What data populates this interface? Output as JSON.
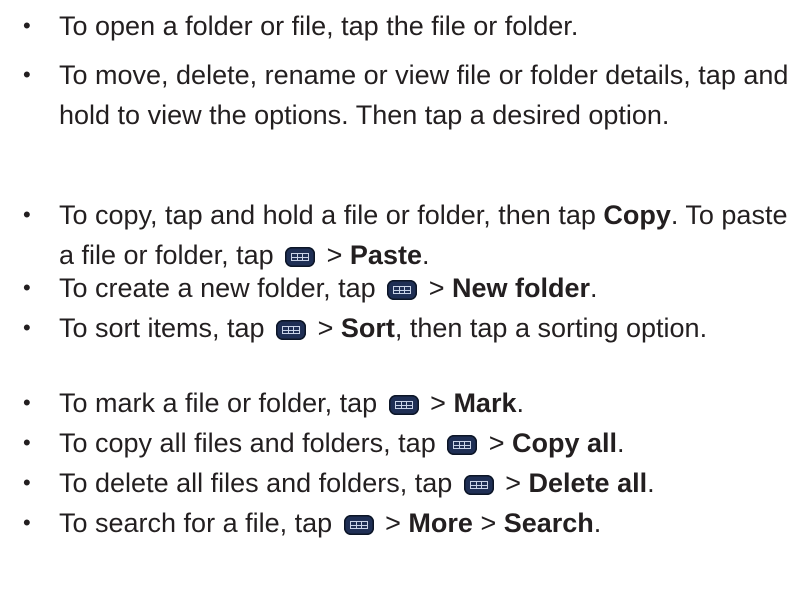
{
  "icon": "menu-icon",
  "items": [
    {
      "segments": [
        {
          "text": "To open a folder or file, tap the file or folder."
        }
      ]
    },
    {
      "segments": [
        {
          "text": "To move, delete, rename or view file or folder details, tap and hold to view the options. Then tap a desired option."
        }
      ]
    },
    {
      "segments": [
        {
          "text": "To copy, tap and hold a file or folder, then tap "
        },
        {
          "text": "Copy",
          "bold": true
        },
        {
          "text": ". To paste a file or folder, tap "
        },
        {
          "icon": "menu-icon"
        },
        {
          "text": " > "
        },
        {
          "text": "Paste",
          "bold": true
        },
        {
          "text": "."
        }
      ]
    },
    {
      "segments": [
        {
          "text": "To create a new folder, tap "
        },
        {
          "icon": "menu-icon"
        },
        {
          "text": " > "
        },
        {
          "text": "New folder",
          "bold": true
        },
        {
          "text": "."
        }
      ]
    },
    {
      "segments": [
        {
          "text": "To sort items, tap "
        },
        {
          "icon": "menu-icon"
        },
        {
          "text": " > "
        },
        {
          "text": "Sort",
          "bold": true
        },
        {
          "text": ", then tap a sorting option."
        }
      ]
    },
    {
      "segments": [
        {
          "text": "To mark a file or folder, tap "
        },
        {
          "icon": "menu-icon"
        },
        {
          "text": " > "
        },
        {
          "text": "Mark",
          "bold": true
        },
        {
          "text": "."
        }
      ]
    },
    {
      "segments": [
        {
          "text": "To copy all files and folders, tap "
        },
        {
          "icon": "menu-icon"
        },
        {
          "text": " > "
        },
        {
          "text": "Copy all",
          "bold": true
        },
        {
          "text": "."
        }
      ]
    },
    {
      "segments": [
        {
          "text": "To delete all files and folders, tap "
        },
        {
          "icon": "menu-icon"
        },
        {
          "text": " > "
        },
        {
          "text": "Delete all",
          "bold": true
        },
        {
          "text": "."
        }
      ]
    },
    {
      "segments": [
        {
          "text": "To search for a file, tap "
        },
        {
          "icon": "menu-icon"
        },
        {
          "text": " > "
        },
        {
          "text": "More",
          "bold": true
        },
        {
          "text": " > "
        },
        {
          "text": "Search",
          "bold": true
        },
        {
          "text": "."
        }
      ]
    }
  ]
}
